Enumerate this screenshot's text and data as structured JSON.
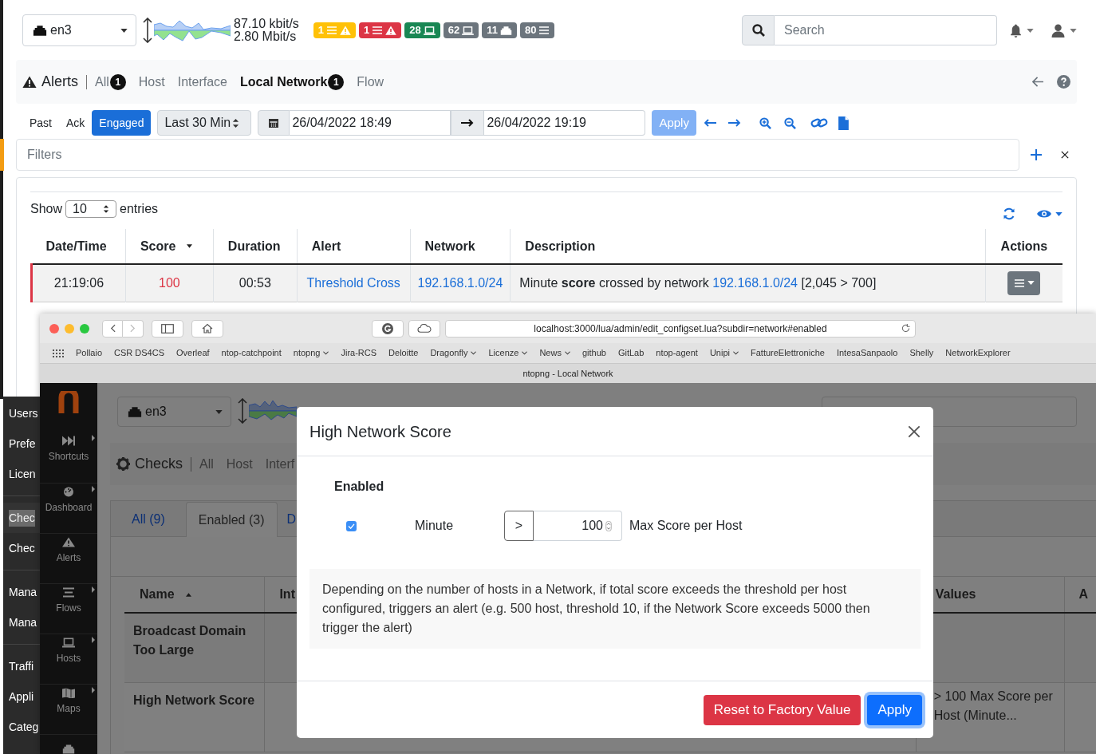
{
  "top_bar": {
    "interface": "en3",
    "upload": "87.10 kbit/s",
    "download": "2.80 Mbit/s",
    "badges": [
      {
        "count": "1",
        "kind": "alert",
        "color": "#ffc107"
      },
      {
        "count": "1",
        "kind": "alert",
        "color": "#dc3545"
      },
      {
        "count": "28",
        "kind": "host",
        "color": "#198754"
      },
      {
        "count": "62",
        "kind": "host",
        "color": "#6c757d"
      },
      {
        "count": "11",
        "kind": "device",
        "color": "#6c757d"
      },
      {
        "count": "80",
        "kind": "flow",
        "color": "#6c757d"
      }
    ],
    "search": {
      "placeholder": "Search"
    }
  },
  "alerts_nav": {
    "title": "Alerts",
    "tabs": [
      {
        "label": "All",
        "count": "1",
        "selected": false
      },
      {
        "label": "Host",
        "selected": false
      },
      {
        "label": "Interface",
        "selected": false
      },
      {
        "label": "Local Network",
        "count": "1",
        "selected": true
      },
      {
        "label": "Flow",
        "selected": false
      }
    ]
  },
  "time_range": {
    "modes": [
      {
        "label": "Past",
        "selected": false
      },
      {
        "label": "Ack",
        "selected": false
      },
      {
        "label": "Engaged",
        "selected": true
      }
    ],
    "preset": "Last 30 Min",
    "begin": "26/04/2022 18:49",
    "end": "26/04/2022 19:19",
    "apply": "Apply"
  },
  "filters": {
    "placeholder": "Filters"
  },
  "alerts_table": {
    "show": "Show",
    "page_size": "10",
    "entries": "entries",
    "columns": [
      {
        "label": "Date/Time"
      },
      {
        "label": "Score",
        "sort_descending": true
      },
      {
        "label": "Duration"
      },
      {
        "label": "Alert"
      },
      {
        "label": "Network"
      },
      {
        "label": "Description"
      },
      {
        "label": "Actions"
      }
    ],
    "rows": [
      {
        "color": "#dc3545",
        "datetime": "21:19:06",
        "score": "100",
        "duration": "00:53",
        "alert": "Threshold Cross",
        "network": "192.168.1.0/24",
        "description": {
          "text": "Minute **score** crossed by network",
          "link": "192.168.1.0/24",
          "suffix": "[2,045 > 700]"
        }
      }
    ]
  },
  "side_menu": {
    "groups": [
      {
        "items": [
          {
            "label": "Users",
            "selected": false
          },
          {
            "label": "Prefe",
            "selected": false
          },
          {
            "label": "Licen",
            "selected": false
          }
        ]
      },
      {
        "items": [
          {
            "label": "Chec",
            "selected": true
          },
          {
            "label": "Chec",
            "selected": false
          }
        ]
      },
      {
        "items": [
          {
            "label": "Mana",
            "selected": false
          },
          {
            "label": "Mana",
            "selected": false
          }
        ]
      },
      {
        "items": [
          {
            "label": "Traffi",
            "selected": false
          },
          {
            "label": "Appli",
            "selected": false
          },
          {
            "label": "Categ",
            "selected": false
          }
        ]
      }
    ]
  },
  "browser": {
    "url": "localhost:3000/lua/admin/edit_configset.lua?subdir=network#enabled",
    "bookmarks": [
      {
        "label": "Pollaio",
        "menu": false
      },
      {
        "label": "CSR DS4CS",
        "menu": false
      },
      {
        "label": "Overleaf",
        "menu": false
      },
      {
        "label": "ntop-catchpoint",
        "menu": false
      },
      {
        "label": "ntopng",
        "menu": true
      },
      {
        "label": "Jira-RCS",
        "menu": false
      },
      {
        "label": "Deloitte",
        "menu": false
      },
      {
        "label": "Dragonfly",
        "menu": true
      },
      {
        "label": "Licenze",
        "menu": true
      },
      {
        "label": "News",
        "menu": true
      },
      {
        "label": "github",
        "menu": false
      },
      {
        "label": "GitLab",
        "menu": false
      },
      {
        "label": "ntop-agent",
        "menu": false
      },
      {
        "label": "Unipi",
        "menu": true
      },
      {
        "label": "FattureElettroniche",
        "menu": false
      },
      {
        "label": "IntesaSanpaolo",
        "menu": false
      },
      {
        "label": "Shelly",
        "menu": false
      },
      {
        "label": "NetworkExplorer",
        "menu": false
      }
    ],
    "tab_title": "ntopng - Local Network"
  },
  "app": {
    "sidebar": [
      {
        "label": "Shortcuts",
        "submenu": true
      },
      {
        "label": "Dashboard",
        "submenu": true
      },
      {
        "label": "Alerts",
        "submenu": false
      },
      {
        "label": "Flows",
        "submenu": true
      },
      {
        "label": "Hosts",
        "submenu": true
      },
      {
        "label": "Maps",
        "submenu": true
      }
    ],
    "interface": "en3",
    "checks": {
      "title": "Checks",
      "links": [
        "All",
        "Host",
        "Interf"
      ]
    },
    "tabs": [
      {
        "label": "All (9)",
        "selected": false
      },
      {
        "label": "Enabled (3)",
        "selected": true
      },
      {
        "label": "D",
        "selected": false
      }
    ],
    "table": {
      "columns": [
        {
          "label": "Name",
          "sort_ascending": true
        },
        {
          "label": "Int"
        },
        {
          "label": "Values"
        },
        {
          "label": "A"
        }
      ],
      "rows": [
        {
          "name": "Broadcast Domain Too Large"
        },
        {
          "name": "High Network Score",
          "values": "> 100 Max Score per Host (Minute..."
        }
      ]
    }
  },
  "modal": {
    "title": "High Network Score",
    "section": "Enabled",
    "rows": [
      {
        "checked": true,
        "label": "Minute",
        "operator": ">",
        "value": "100",
        "unit": "Max Score per Host"
      }
    ],
    "description": "Depending on the number of hosts in a Network, if total score exceeds the threshold per host configured, triggers an alert (e.g. 500 host, threshold 10, if the Network Score exceeds 5000 then trigger the alert)",
    "buttons": [
      {
        "label": "Reset to Factory Value",
        "kind": "danger"
      },
      {
        "label": "Apply",
        "kind": "primary"
      }
    ]
  }
}
